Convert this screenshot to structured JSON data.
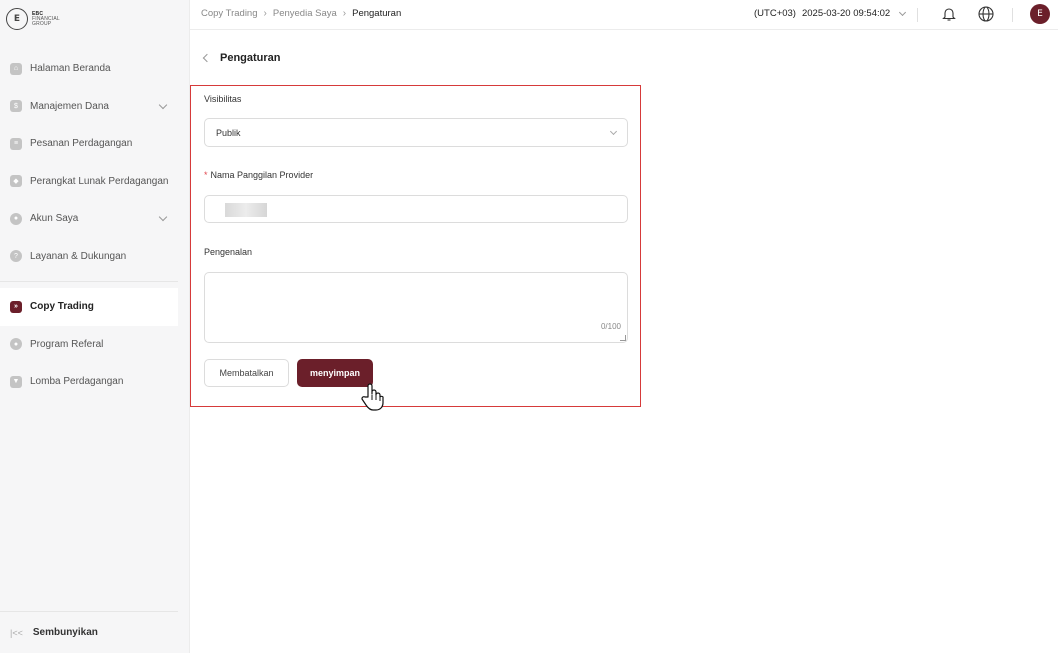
{
  "brand": {
    "logo_mark": "E",
    "line1": "EBC",
    "line2": "FINANCIAL",
    "line3": "GROUP"
  },
  "sidebar": {
    "items": [
      {
        "label": "Halaman Beranda",
        "icon": "home-icon",
        "expandable": false
      },
      {
        "label": "Manajemen Dana",
        "icon": "wallet-icon",
        "expandable": true
      },
      {
        "label": "Pesanan Perdagangan",
        "icon": "orders-icon",
        "expandable": false
      },
      {
        "label": "Perangkat Lunak Perdagangan",
        "icon": "software-icon",
        "expandable": false
      },
      {
        "label": "Akun Saya",
        "icon": "user-icon",
        "expandable": true
      },
      {
        "label": "Layanan & Dukungan",
        "icon": "help-icon",
        "expandable": false
      },
      {
        "label": "Copy Trading",
        "icon": "copy-trading-icon",
        "active": true
      },
      {
        "label": "Program Referal",
        "icon": "referral-icon"
      },
      {
        "label": "Lomba Perdagangan",
        "icon": "trophy-icon"
      }
    ],
    "collapse_label": "Sembunyikan",
    "collapse_icon_glyph": "|<<"
  },
  "header": {
    "breadcrumb": [
      "Copy Trading",
      "Penyedia Saya",
      "Pengaturan"
    ],
    "timezone": "(UTC+03)",
    "datetime": "2025-03-20 09:54:02",
    "avatar_glyph": "E"
  },
  "page": {
    "title": "Pengaturan",
    "visibility": {
      "label": "Visibilitas",
      "value": "Publik"
    },
    "nickname": {
      "label": "Nama Panggilan Provider",
      "required_mark": "*"
    },
    "intro": {
      "label": "Pengenalan",
      "counter": "0/100"
    },
    "buttons": {
      "cancel": "Membatalkan",
      "save": "menyimpan"
    }
  },
  "colors": {
    "accent": "#6b1f2a",
    "highlight_border": "#d63a3a",
    "required": "#e0464e"
  }
}
